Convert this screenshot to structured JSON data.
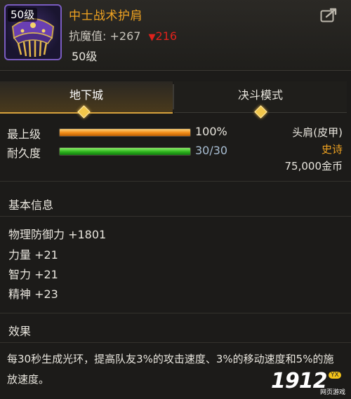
{
  "item": {
    "name": "中士战术护肩",
    "level_badge": "50级",
    "resist_label": "抗魔值:",
    "resist_value": "+267",
    "resist_delta": "216",
    "level_text": "50级",
    "icon": "shoulder-armor-icon"
  },
  "tabs": [
    {
      "label": "地下城",
      "active": true
    },
    {
      "label": "决斗模式",
      "active": false
    }
  ],
  "bars": {
    "upgrade": {
      "label": "最上级",
      "value_text": "100%",
      "fraction": 1.0,
      "color": "#f08a14"
    },
    "durability": {
      "label": "耐久度",
      "value_text": "30/30",
      "fraction": 1.0,
      "color": "#2cb31c"
    }
  },
  "info": {
    "slot": "头肩(皮甲)",
    "rarity": "史诗",
    "price": "75,000金币"
  },
  "basic_info": {
    "title": "基本信息",
    "stats": [
      "物理防御力 +1801",
      "力量 +21",
      "智力 +21",
      "精神 +23"
    ]
  },
  "effect": {
    "title": "效果",
    "text": "每30秒生成光环，提高队友3%的攻击速度、3%的移动速度和5%的施放速度。"
  },
  "watermark": {
    "number": "1912",
    "badge": "YX",
    "subtitle": "网页游戏"
  },
  "colors": {
    "name": "#f0a321",
    "rarity": "#f0a321",
    "delta": "#e0221c",
    "durability_text": "#a9bfd4",
    "icon_border": "#7a5cc0",
    "tab_accent": "#d7a23c"
  }
}
